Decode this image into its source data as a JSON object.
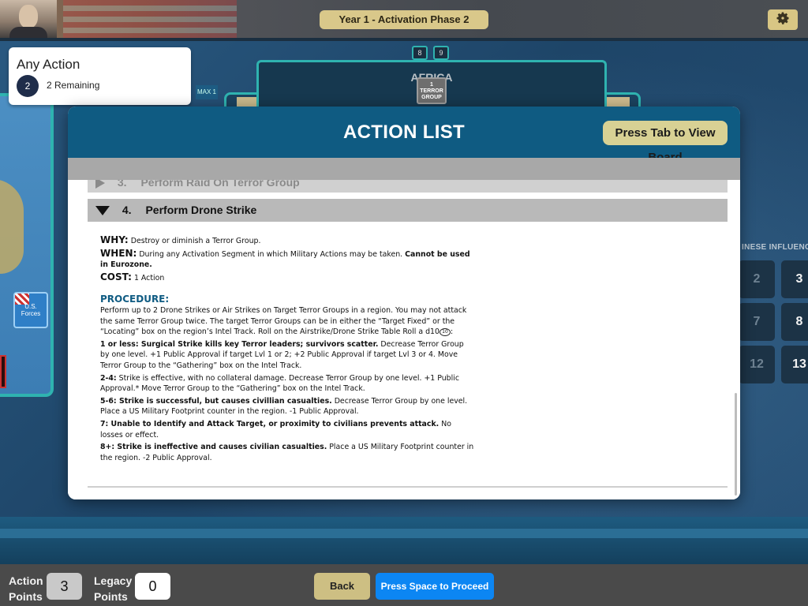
{
  "header": {
    "phase": "Year 1  -  Activation Phase 2"
  },
  "any_action": {
    "title": "Any Action",
    "remaining_count": "2",
    "remaining_label": "2 Remaining"
  },
  "board": {
    "region_title": "AFRICA",
    "terror_token_number": "1",
    "terror_token_line1": "TERROR",
    "terror_token_line2": "GROUP",
    "top_numbers": [
      "8",
      "9"
    ],
    "max_tag": "MAX 1",
    "us_forces_label": "U.S. Forces",
    "influence_label": "INESE INFLUENCE",
    "influence_cells": [
      "2",
      "3",
      "7",
      "8",
      "12",
      "13"
    ]
  },
  "modal": {
    "title": "ACTION LIST",
    "tab_button": "Press Tab to View Board",
    "prev_item": {
      "number": "3.",
      "label": "Perform Raid On Terror Group"
    },
    "open_item": {
      "number": "4.",
      "label": "Perform Drone Strike"
    },
    "why_label": "WHY:",
    "why_text": "Destroy or diminish a Terror Group.",
    "when_label": "WHEN:",
    "when_text": "During any Activation Segment in which Military Actions may be taken.",
    "when_bold": "Cannot be used in Eurozone.",
    "cost_label": "COST:",
    "cost_text": "1 Action",
    "procedure_label": "PROCEDURE:",
    "procedure_text": "Perform up to 2 Drone Strikes or Air Strikes on Target Terror Groups in a region. You may not attack the same Terror Group twice. The target Terror Groups can be in either the “Target Fixed” or the “Locating” box on the region’s Intel Track. Roll on the Airstrike/Drone Strike Table",
    "roll_text": "Roll a d10",
    "dice_icon_label": "10",
    "results": [
      {
        "bold": "1 or less: Surgical Strike kills key Terror leaders; survivors scatter.",
        "text": "Decrease Terror Group by one level. +1 Public Approval if target Lvl 1 or 2; +2 Public Approval if target Lvl 3 or 4. Move Terror Group to the “Gathering” box on the Intel Track."
      },
      {
        "bold": "2-4:",
        "text": "Strike is effective, with no collateral damage. Decrease Terror Group by one level. +1 Public Approval.* Move Terror Group to the “Gathering” box on the Intel Track."
      },
      {
        "bold": "5-6: Strike is successful, but causes civillian casualties.",
        "text": "Decrease Terror Group by one level. Place a US Military Footprint counter in the region. -1 Public Approval."
      },
      {
        "bold": "7: Unable to Identify and Attack Target, or proximity to civilians prevents attack.",
        "text": "No losses or effect."
      },
      {
        "bold": "8+: Strike is ineffective and causes civilian casualties.",
        "text": "Place a US Military Footprint counter in the region. -2 Public Approval."
      }
    ]
  },
  "bottom": {
    "action_points_label": "Action Points",
    "action_points_value": "3",
    "legacy_points_label": "Legacy Points",
    "legacy_points_value": "0",
    "back_button": "Back",
    "proceed_button": "Press Space to Proceed"
  },
  "colors": {
    "header_blue": "#0f5b82",
    "proceed_blue": "#0c86f3",
    "gold": "#d9c88a",
    "teal_border": "#2fb3b0"
  },
  "icons": {
    "settings": "gear-icon",
    "collapsed": "chevron-right-icon",
    "expanded": "chevron-down-icon",
    "dice": "d10-dice-icon"
  }
}
